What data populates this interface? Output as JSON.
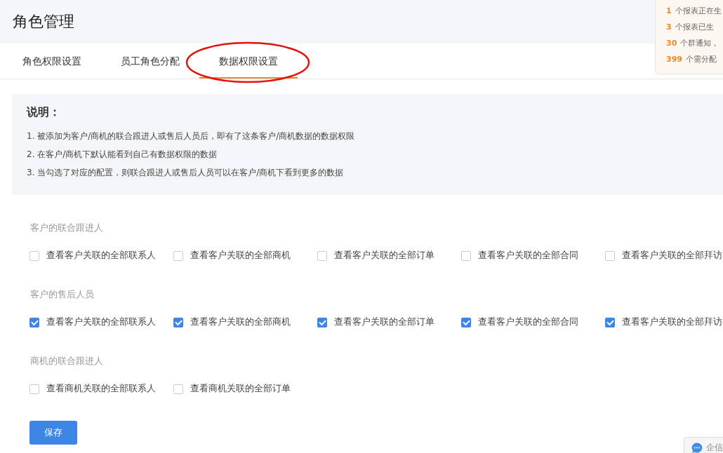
{
  "page_title": "角色管理",
  "tabs": [
    {
      "label": "角色权限设置",
      "selected": false
    },
    {
      "label": "员工角色分配",
      "selected": false
    },
    {
      "label": "数据权限设置",
      "selected": true
    }
  ],
  "notifications": [
    {
      "count": "1",
      "text": "个报表正在生"
    },
    {
      "count": "3",
      "text": "个报表已生"
    },
    {
      "count": "30",
      "text": "个群通知，"
    },
    {
      "count": "399",
      "text": "个需分配"
    }
  ],
  "notice": {
    "title": "说明：",
    "lines": [
      "1. 被添加为客户/商机的联合跟进人或售后人员后，即有了这条客户/商机数据的数据权限",
      "2. 在客户/商机下默认能看到自己有数据权限的数据",
      "3. 当勾选了对应的配置，则联合跟进人或售后人员可以在客户/商机下看到更多的数据"
    ]
  },
  "sections": [
    {
      "title": "客户的联合跟进人",
      "options": [
        {
          "label": "查看客户关联的全部联系人",
          "checked": false
        },
        {
          "label": "查看客户关联的全部商机",
          "checked": false
        },
        {
          "label": "查看客户关联的全部订单",
          "checked": false
        },
        {
          "label": "查看客户关联的全部合同",
          "checked": false
        },
        {
          "label": "查看客户关联的全部拜访",
          "checked": false
        }
      ]
    },
    {
      "title": "客户的售后人员",
      "options": [
        {
          "label": "查看客户关联的全部联系人",
          "checked": true
        },
        {
          "label": "查看客户关联的全部商机",
          "checked": true
        },
        {
          "label": "查看客户关联的全部订单",
          "checked": true
        },
        {
          "label": "查看客户关联的全部合同",
          "checked": true
        },
        {
          "label": "查看客户关联的全部拜访",
          "checked": true
        }
      ]
    },
    {
      "title": "商机的联合跟进人",
      "options": [
        {
          "label": "查看商机关联的全部联系人",
          "checked": false
        },
        {
          "label": "查看商机关联的全部订单",
          "checked": false
        }
      ]
    }
  ],
  "save_button": "保存",
  "chat_widget": "企信"
}
